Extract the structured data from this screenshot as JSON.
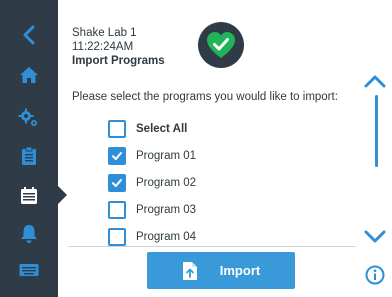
{
  "header": {
    "device_name": "Shake Lab 1",
    "time": "11:22:24AM",
    "page_title": "Import Programs"
  },
  "instructions": "Please select the programs you would like to import:",
  "program_list": {
    "select_all": {
      "label": "Select All",
      "checked": false
    },
    "items": [
      {
        "label": "Program 01",
        "checked": true
      },
      {
        "label": "Program 02",
        "checked": true
      },
      {
        "label": "Program 03",
        "checked": false
      },
      {
        "label": "Program 04",
        "checked": false
      }
    ]
  },
  "import_button": {
    "label": "Import",
    "icon": "file-import-icon"
  },
  "sidebar": {
    "items": [
      {
        "icon": "back-chevron-icon"
      },
      {
        "icon": "home-icon"
      },
      {
        "icon": "settings-gears-icon"
      },
      {
        "icon": "clipboard-icon"
      },
      {
        "icon": "programs-icon",
        "active": true
      },
      {
        "icon": "bell-icon"
      },
      {
        "icon": "keyboard-icon"
      }
    ]
  },
  "colors": {
    "sidebar_bg": "#2f3c47",
    "sidebar_icon": "#2e8fd8",
    "accent": "#2e8fd8",
    "button_bg": "#3a9ad9",
    "status_ok": "#21b35a"
  }
}
